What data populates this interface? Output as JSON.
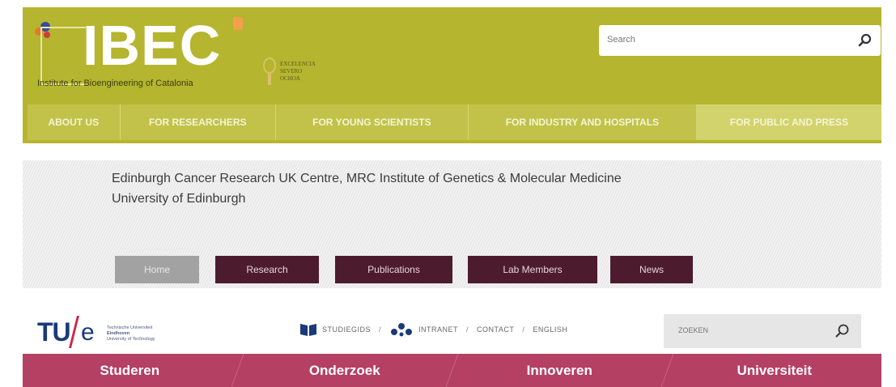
{
  "ibec": {
    "logo_text": "IBEC",
    "subtitle": "Institute for Bioengineering of Catalonia",
    "excellence_lines": [
      "EXCELENCIA",
      "SEVERO",
      "OCHOA"
    ],
    "search_placeholder": "Search",
    "nav": [
      "ABOUT US",
      "FOR RESEARCHERS",
      "FOR YOUNG SCIENTISTS",
      "FOR INDUSTRY AND HOSPITALS",
      "FOR PUBLIC AND PRESS"
    ],
    "active_nav_index": 4,
    "colors": {
      "background": "#b5b52f",
      "nav": "#c2c24a",
      "accent": "#f2a14a"
    }
  },
  "edinburgh": {
    "title_line1": "Edinburgh Cancer Research UK Centre, MRC Institute of Genetics & Molecular Medicine",
    "title_line2": "University of Edinburgh",
    "tabs": [
      "Home",
      "Research",
      "Publications",
      "Lab Members",
      "News"
    ],
    "active_tab_index": 0,
    "colors": {
      "tab": "#4c1b2e",
      "tab_active": "#a2a2a2"
    }
  },
  "tue": {
    "logo_tu": "TU",
    "logo_e": "e",
    "logo_sub_lines": [
      "Technische Universiteit",
      "Eindhoven",
      "University of Technology"
    ],
    "top_links": [
      "STUDIEGIDS",
      "INTRANET",
      "CONTACT",
      "ENGLISH"
    ],
    "search_placeholder": "ZOEKEN",
    "nav": [
      "Studeren",
      "Onderzoek",
      "Innoveren",
      "Universiteit"
    ],
    "colors": {
      "nav": "#b44064",
      "logo": "#1a3a7a",
      "slash": "#c72a4b"
    }
  }
}
